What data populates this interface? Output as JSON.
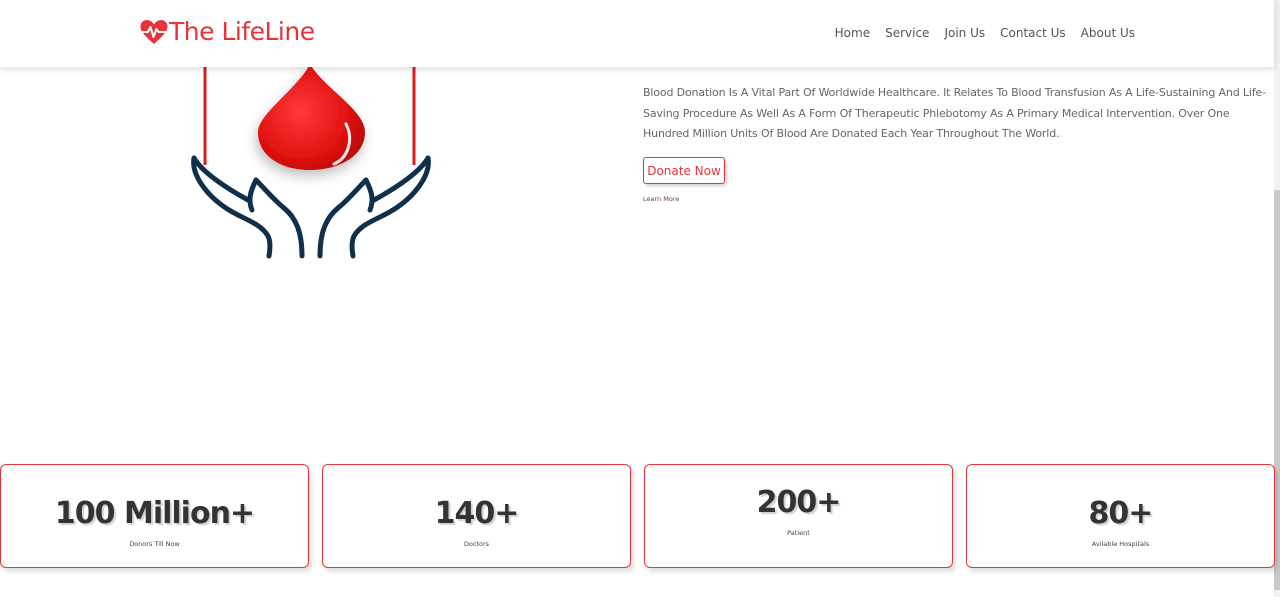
{
  "brand": {
    "name": "The LifeLine",
    "icon": "heart-pulse-icon",
    "color": "#e8333a"
  },
  "nav": {
    "items": [
      {
        "label": "Home"
      },
      {
        "label": "Service"
      },
      {
        "label": "Join Us"
      },
      {
        "label": "Contact Us"
      },
      {
        "label": "About Us"
      }
    ]
  },
  "hero": {
    "illustration": "blood-drop-hands-icon",
    "description": "Blood Donation Is A Vital Part Of Worldwide Healthcare. It Relates To Blood Transfusion As A Life-Sustaining And Life-Saving Procedure As Well As A Form Of Therapeutic Phlebotomy As A Primary Medical Intervention. Over One Hundred Million Units Of Blood Are Donated Each Year Throughout The World.",
    "donate_label": "Donate Now",
    "learn_more_label": "Learn More"
  },
  "stats": [
    {
      "value": "100 Million+",
      "label": "Donors Till Now"
    },
    {
      "value": "140+",
      "label": "Doctors"
    },
    {
      "value": "200+",
      "label": "Patient"
    },
    {
      "value": "80+",
      "label": "Avilable Hospitals"
    }
  ],
  "colors": {
    "accent": "#e8333a",
    "navy": "#0f2f4a",
    "text": "#555555"
  }
}
